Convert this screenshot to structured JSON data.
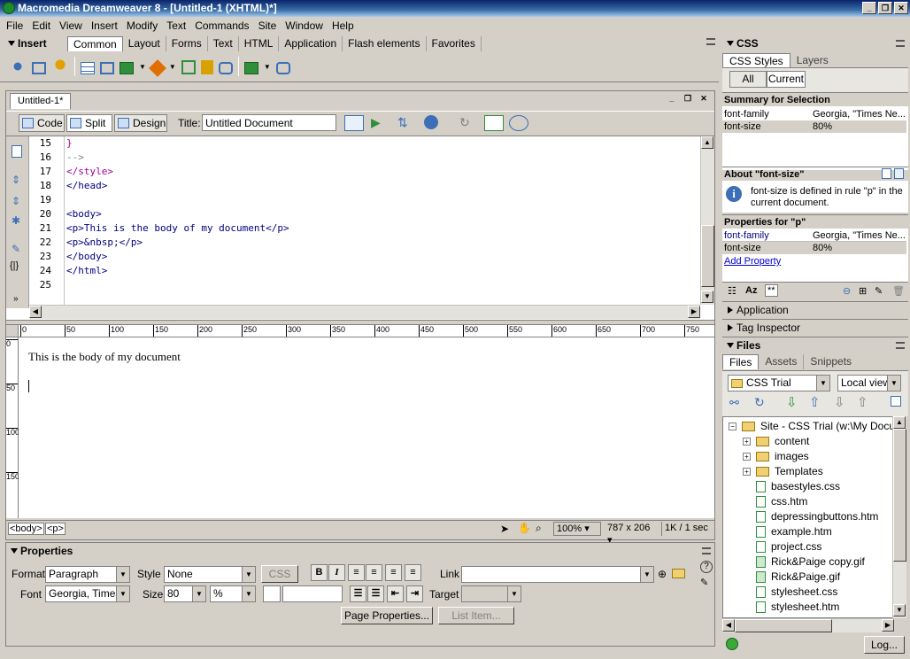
{
  "window": {
    "title": "Macromedia Dreamweaver 8 - [Untitled-1 (XHTML)*]",
    "controls": {
      "minimize": "_",
      "restore": "❐",
      "close": "✕"
    }
  },
  "menu": [
    "File",
    "Edit",
    "View",
    "Insert",
    "Modify",
    "Text",
    "Commands",
    "Site",
    "Window",
    "Help"
  ],
  "insert_bar": {
    "label": "Insert",
    "tabs": [
      "Common",
      "Layout",
      "Forms",
      "Text",
      "HTML",
      "Application",
      "Flash elements",
      "Favorites"
    ],
    "active_tab": "Common",
    "icons": [
      "hyperlink-icon",
      "email-link-icon",
      "named-anchor-icon",
      "table-icon",
      "layer-icon",
      "image-icon",
      "media-icon",
      "date-icon",
      "comment-icon",
      "head-icon",
      "script-icon",
      "templates-icon",
      "tag-chooser-icon"
    ]
  },
  "document": {
    "tab_label": "Untitled-1*",
    "views": {
      "code": "Code",
      "split": "Split",
      "design": "Design"
    },
    "active_view": "Split",
    "title_label": "Title:",
    "title_value": "Untitled Document",
    "code_lines": [
      {
        "n": "15",
        "text": "}"
      },
      {
        "n": "16",
        "text": "-->"
      },
      {
        "n": "17",
        "text": "</style>"
      },
      {
        "n": "18",
        "text": "</head>"
      },
      {
        "n": "19",
        "text": ""
      },
      {
        "n": "20",
        "text": "<body>"
      },
      {
        "n": "21",
        "text": "<p>This is the body of my document</p>"
      },
      {
        "n": "22",
        "text": "<p>&nbsp;</p>"
      },
      {
        "n": "23",
        "text": "</body>"
      },
      {
        "n": "24",
        "text": "</html>"
      },
      {
        "n": "25",
        "text": ""
      }
    ],
    "ruler_top": [
      "0",
      "50",
      "100",
      "150",
      "200",
      "250",
      "300",
      "350",
      "400",
      "450",
      "500",
      "550",
      "600",
      "650",
      "700",
      "750"
    ],
    "ruler_left": [
      "0",
      "50",
      "100",
      "150"
    ],
    "design_text": "This is the body of my document",
    "status": {
      "tags": [
        "<body>",
        "<p>"
      ],
      "zoom": "100%",
      "size": "787 x 206",
      "download": "1K / 1 sec"
    }
  },
  "properties": {
    "title": "Properties",
    "format_label": "Format",
    "format_value": "Paragraph",
    "style_label": "Style",
    "style_value": "None",
    "css_button": "CSS",
    "bold": "B",
    "italic": "I",
    "link_label": "Link",
    "link_value": "",
    "font_label": "Font",
    "font_value": "Georgia, Times",
    "size_label": "Size",
    "size_value": "80",
    "unit_value": "%",
    "target_label": "Target",
    "page_properties_button": "Page Properties...",
    "list_item_button": "List Item..."
  },
  "css_panel": {
    "title": "CSS",
    "tabs": [
      "CSS Styles",
      "Layers"
    ],
    "active_tab": "CSS Styles",
    "modes": [
      "All",
      "Current"
    ],
    "active_mode": "Current",
    "summary_title": "Summary for Selection",
    "summary_rows": [
      {
        "k": "font-family",
        "v": "Georgia, \"Times Ne..."
      },
      {
        "k": "font-size",
        "v": "80%"
      }
    ],
    "about_title": "About \"font-size\"",
    "about_text": "font-size is defined in rule \"p\" in the current document.",
    "props_title": "Properties for \"p\"",
    "props_rows": [
      {
        "k": "font-family",
        "v": "Georgia, \"Times Ne..."
      },
      {
        "k": "font-size",
        "v": "80%"
      }
    ],
    "add_property": "Add Property"
  },
  "collapsed_panels": [
    "Application",
    "Tag Inspector"
  ],
  "files_panel": {
    "title": "Files",
    "tabs": [
      "Files",
      "Assets",
      "Snippets"
    ],
    "active_tab": "Files",
    "site_select": "CSS Trial",
    "view_select": "Local view",
    "tree_root": "Site - CSS Trial (w:\\My Docum",
    "items": [
      {
        "name": "content",
        "type": "folder"
      },
      {
        "name": "images",
        "type": "folder"
      },
      {
        "name": "Templates",
        "type": "folder"
      },
      {
        "name": "basestyles.css",
        "type": "file"
      },
      {
        "name": "css.htm",
        "type": "file"
      },
      {
        "name": "depressingbuttons.htm",
        "type": "file"
      },
      {
        "name": "example.htm",
        "type": "file"
      },
      {
        "name": "project.css",
        "type": "file"
      },
      {
        "name": "Rick&Paige copy.gif",
        "type": "file"
      },
      {
        "name": "Rick&Paige.gif",
        "type": "file"
      },
      {
        "name": "stylesheet.css",
        "type": "file"
      },
      {
        "name": "stylesheet.htm",
        "type": "file"
      }
    ],
    "log_button": "Log..."
  }
}
